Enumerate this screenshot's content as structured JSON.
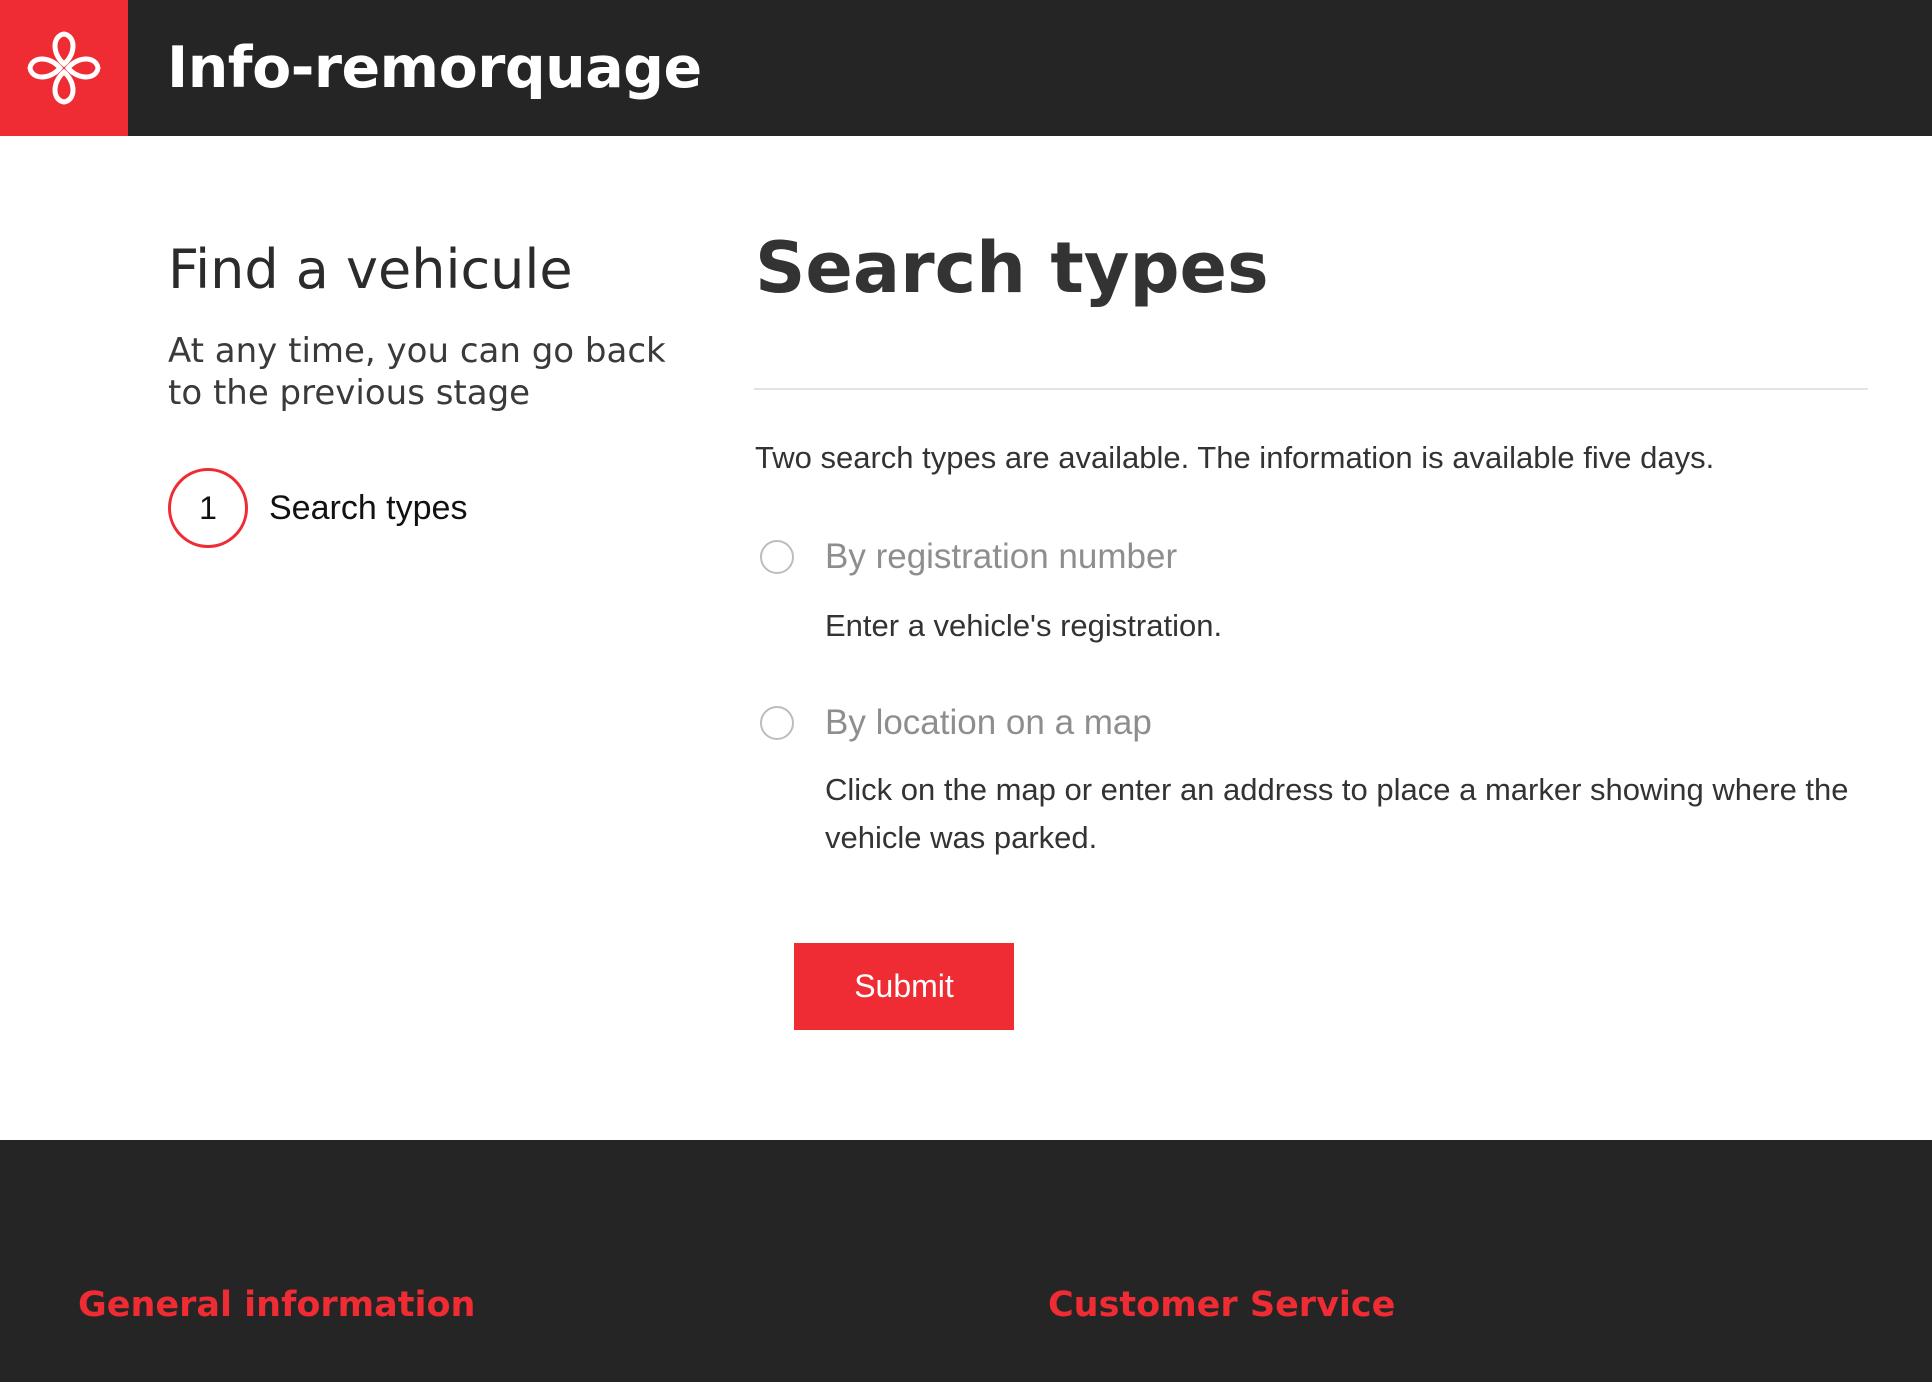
{
  "header": {
    "logo_icon": "montreal-rosette-icon",
    "brand_color": "#ef2b33",
    "title": "Info-remorquage"
  },
  "sidebar": {
    "title": "Find a vehicule",
    "subtitle": "At any time, you can go back to the previous stage",
    "steps": [
      {
        "number": "1",
        "label": "Search types"
      }
    ]
  },
  "main": {
    "title": "Search types",
    "intro": "Two search types are available. The information is available five days.",
    "options": [
      {
        "label": "By registration number",
        "description": "Enter a vehicle's registration.",
        "selected": false
      },
      {
        "label": "By location on a map",
        "description": "Click on the map or enter an address to place a marker showing where the vehicle was parked.",
        "selected": false
      }
    ],
    "submit_label": "Submit"
  },
  "footer": {
    "headings": [
      "General information",
      "Customer Service"
    ]
  }
}
